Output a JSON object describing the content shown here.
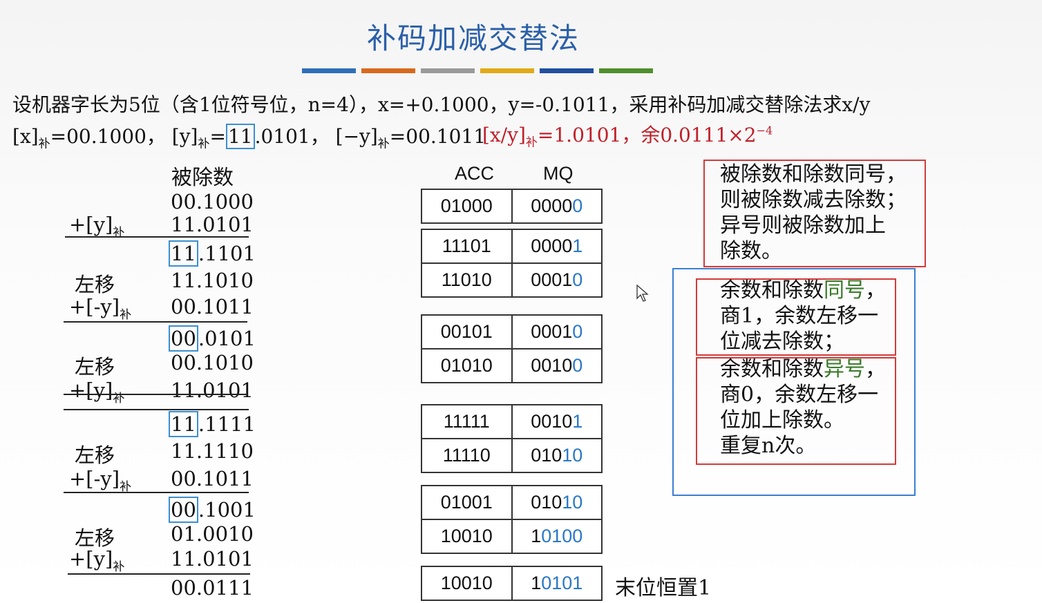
{
  "title": "补码加减交替法",
  "bar_colors": [
    "#2f6fb8",
    "#d9691c",
    "#9a9a9a",
    "#e3aa17",
    "#1f4f9e",
    "#4f8f2c"
  ],
  "problem": {
    "line1": "设机器字长为5位（含1位符号位，n=4），x=+0.1000，y=-0.1011，采用补码加减交替除法求x/y",
    "x_comp_a": "[x]",
    "x_comp_sub": "补",
    "x_comp_b": "=00.1000，",
    "y_comp_a": "[y]",
    "y_comp_sub": "补",
    "y_comp_eq": "=",
    "y_comp_box": "11",
    "y_comp_b": ".0101，",
    "ny_comp_a": "[−y]",
    "ny_comp_sub": "补",
    "ny_comp_b": "=00.1011",
    "result_a": "[x/y]",
    "result_sub": "补",
    "result_b": "=1.0101，余0.0111×2",
    "result_exp": "−4"
  },
  "division": {
    "header": "被除数",
    "sub": "补",
    "rows": [
      {
        "label": "",
        "value": "00.1000"
      },
      {
        "label": "+[y]",
        "value": "11.0101"
      },
      {
        "label": "",
        "box": "11",
        "value": ".1101"
      },
      {
        "label": "左移",
        "value": "11.1010"
      },
      {
        "label": "+[-y]",
        "value": "00.1011"
      },
      {
        "label": "",
        "box": "00",
        "value": ".0101"
      },
      {
        "label": "左移",
        "value": "00.1010"
      },
      {
        "label": "+[y]",
        "value": "11.0101"
      },
      {
        "label": "",
        "box": "11",
        "value": ".1111"
      },
      {
        "label": "左移",
        "value": "11.1110"
      },
      {
        "label": "+[-y]",
        "value": "00.1011"
      },
      {
        "label": "",
        "box": "00",
        "value": ".1001"
      },
      {
        "label": "左移",
        "value": "01.0010"
      },
      {
        "label": "+[y]",
        "value": "11.0101"
      },
      {
        "label": "",
        "value": "00.0111"
      }
    ]
  },
  "registers": {
    "acc_header": "ACC",
    "mq_header": "MQ",
    "groups": [
      [
        [
          "01000",
          "0000",
          "0"
        ]
      ],
      [
        [
          "11101",
          "0000",
          "1"
        ],
        [
          "11010",
          "0001",
          "0"
        ]
      ],
      [
        [
          "00101",
          "0001",
          "0"
        ],
        [
          "01010",
          "0010",
          "0"
        ]
      ],
      [
        [
          "11111",
          "0010",
          "1"
        ],
        [
          "11110",
          "010",
          "10"
        ]
      ],
      [
        [
          "01001",
          "010",
          "10"
        ],
        [
          "10010",
          "1",
          "0100"
        ]
      ],
      [
        [
          "10010",
          "1",
          "0101"
        ]
      ]
    ],
    "tail_note": "末位恒置1"
  },
  "notes": {
    "rule1": "被除数和除数同号，\n则被除数减去除数；\n异号则被除数加上\n除数。",
    "rule2_a": "余数和除数",
    "rule2_hl": "同号",
    "rule2_b": "，\n商1，余数左移一\n位减去除数；",
    "rule3_a": "余数和除数",
    "rule3_hl": "异号",
    "rule3_b": "，\n商0，余数左移一\n位加上除数。\n重复n次。"
  }
}
